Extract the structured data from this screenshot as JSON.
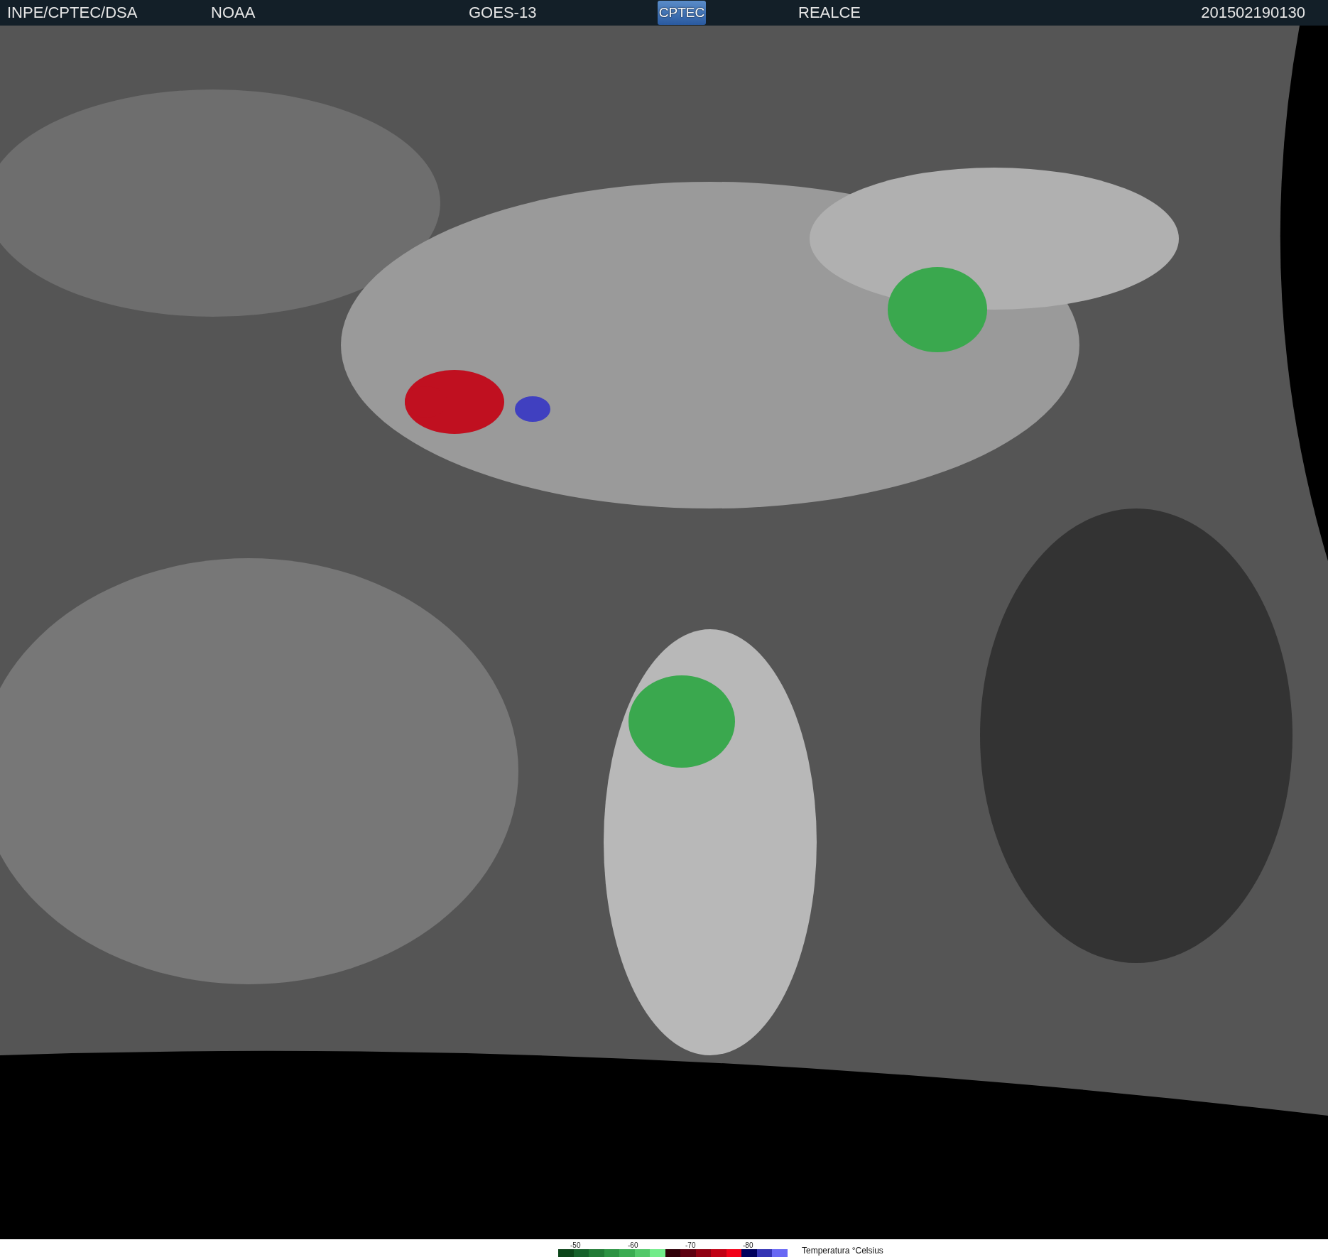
{
  "header": {
    "agency": "INPE/CPTEC/DSA",
    "source": "NOAA",
    "satellite": "GOES-13",
    "logo": "CPTEC",
    "enhancement": "REALCE",
    "timestamp": "201502190130"
  },
  "legend": {
    "ticks": [
      "-50",
      "-60",
      "-70",
      "-80"
    ],
    "title": "Temperatura °Celsius",
    "swatches": [
      {
        "color": "#0b4519"
      },
      {
        "color": "#15612a"
      },
      {
        "color": "#207a35"
      },
      {
        "color": "#2b9342"
      },
      {
        "color": "#3aac52"
      },
      {
        "color": "#52c86a"
      },
      {
        "color": "#72ec8a"
      },
      {
        "color": "#300008"
      },
      {
        "color": "#5e0010"
      },
      {
        "color": "#900012"
      },
      {
        "color": "#c00014"
      },
      {
        "color": "#f20018"
      },
      {
        "color": "#00005e"
      },
      {
        "color": "#3434b4"
      },
      {
        "color": "#6868f4"
      }
    ]
  }
}
